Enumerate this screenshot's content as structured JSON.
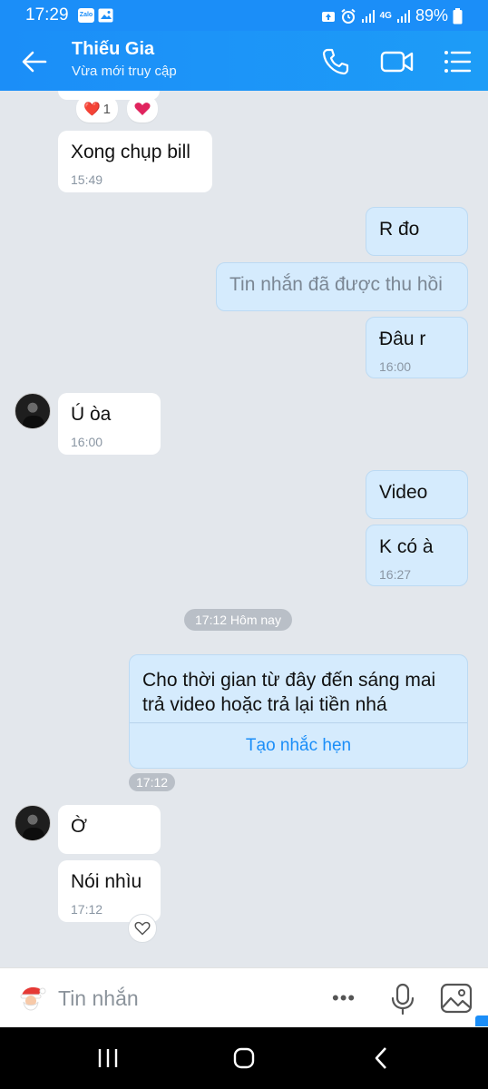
{
  "status_bar": {
    "time": "17:29",
    "zalo_badge": "Zalo",
    "network": "4G",
    "battery": "89%"
  },
  "header": {
    "title": "Thiếu Gia",
    "subtitle": "Vừa mới truy cập"
  },
  "messages": [
    {
      "id": "m1",
      "direction": "in",
      "text": "Xong chụp bill",
      "time": "15:49"
    },
    {
      "id": "m2",
      "direction": "out",
      "text": "R đo"
    },
    {
      "id": "m3",
      "direction": "out",
      "text": "Tin nhắn đã được thu hồi",
      "recalled": true
    },
    {
      "id": "m4",
      "direction": "out",
      "text": "Đâu r",
      "time": "16:00"
    },
    {
      "id": "m5",
      "direction": "in",
      "text": "Ú òa",
      "time": "16:00"
    },
    {
      "id": "m6",
      "direction": "out",
      "text": "Video"
    },
    {
      "id": "m7",
      "direction": "out",
      "text": "K có à",
      "time": "16:27"
    },
    {
      "id": "m8",
      "direction": "in",
      "text": "Ờ"
    },
    {
      "id": "m9",
      "direction": "in",
      "text": "Nói nhìu",
      "time": "17:12"
    }
  ],
  "reaction": {
    "emoji": "❤️",
    "count": "1"
  },
  "day_separator": "17:12 Hôm nay",
  "reminder": {
    "text": "Cho thời gian từ đây đến sáng mai trả video hoặc trả lại tiền nhá",
    "action": "Tạo nhắc hẹn",
    "time": "17:12"
  },
  "composer": {
    "placeholder": "Tin nhắn",
    "more_label": "•••"
  },
  "colors": {
    "brand": "#1b8ef8",
    "outgoing_bubble": "#d5ebfd",
    "incoming_bubble": "#ffffff",
    "chat_background": "#e3e7ec"
  }
}
